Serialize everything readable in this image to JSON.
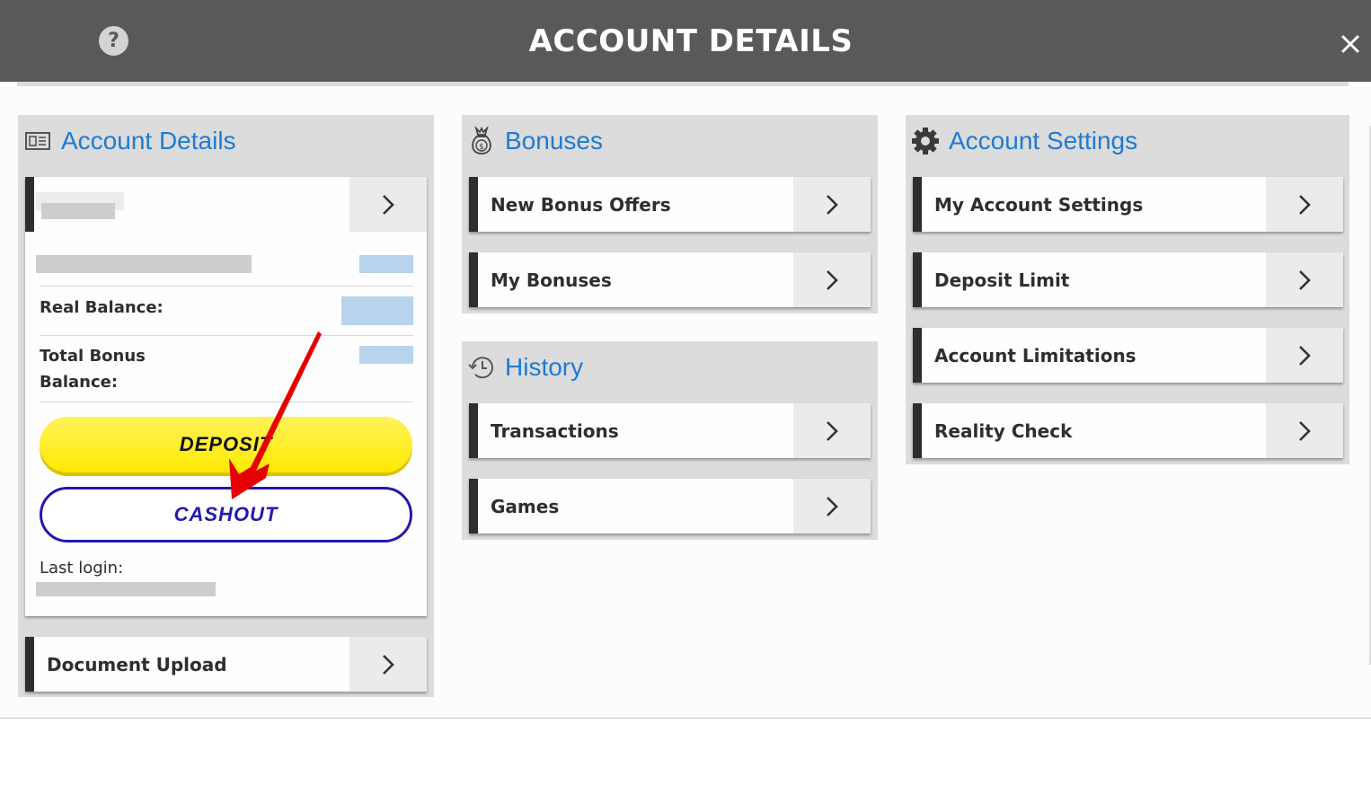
{
  "header": {
    "title": "ACCOUNT DETAILS",
    "help_icon": "question-circle-icon",
    "close_icon": "close-x-icon"
  },
  "account_details": {
    "title": "Account Details",
    "icon": "id-card-icon",
    "username_row": {
      "value": "[redacted]"
    },
    "account_id": {
      "value": "[redacted]",
      "amount": "[redacted]"
    },
    "real_balance": {
      "label": "Real Balance:",
      "value": "[redacted]"
    },
    "total_bonus_balance": {
      "label_line1": "Total Bonus",
      "label_line2": "Balance:",
      "value": "[redacted]"
    },
    "deposit_label": "DEPOSIT",
    "cashout_label": "CASHOUT",
    "last_login": {
      "label": "Last login:",
      "value": "[redacted]"
    },
    "document_upload": "Document Upload"
  },
  "bonuses": {
    "title": "Bonuses",
    "icon": "money-bag-icon",
    "items": [
      {
        "label": "New Bonus Offers"
      },
      {
        "label": "My Bonuses"
      }
    ]
  },
  "history": {
    "title": "History",
    "icon": "history-clock-icon",
    "items": [
      {
        "label": "Transactions"
      },
      {
        "label": "Games"
      }
    ]
  },
  "account_settings": {
    "title": "Account Settings",
    "icon": "gear-icon",
    "items": [
      {
        "label": "My Account Settings"
      },
      {
        "label": "Deposit Limit"
      },
      {
        "label": "Account Limitations"
      },
      {
        "label": "Reality Check"
      }
    ]
  },
  "colors": {
    "header_bg": "#595959",
    "section_title": "#1e7bd3",
    "deposit_yellow": "#ffe900",
    "cashout_blue": "#2418b0",
    "annotation_red": "#e60000"
  }
}
